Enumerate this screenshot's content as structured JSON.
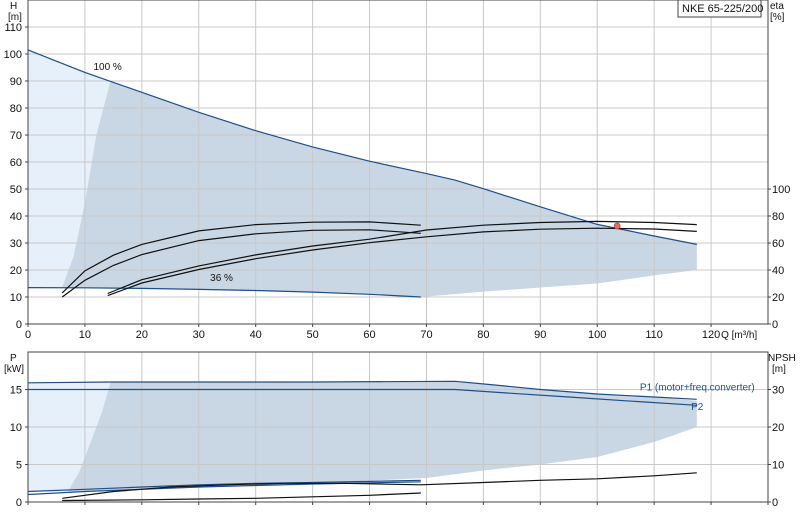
{
  "colors": {
    "grid": "#c8c8c8",
    "axis": "#444444",
    "envelope": "#c9d6e3",
    "lowflow": "#e6f0fb",
    "curve_blue": "#1e4f8a",
    "curve_black": "#111111",
    "duty_point": "#e07060"
  },
  "model_label": "NKE 65-225/200",
  "chart_data": [
    {
      "type": "line",
      "panel": "top",
      "title": "",
      "ylabel_left_name": "H",
      "ylabel_left_unit": "[m]",
      "ylabel_right_name": "eta",
      "ylabel_right_unit": "[%]",
      "xlabel": "Q [m³/h]",
      "xlim": [
        0,
        130
      ],
      "ylim_left": [
        0,
        120
      ],
      "ylim_right_scale": {
        "eta_0_at_H": 0,
        "eta_100_at_H": 50
      },
      "x_ticks": [
        0,
        10,
        20,
        30,
        40,
        50,
        60,
        70,
        80,
        90,
        100,
        110,
        120
      ],
      "y_ticks_left": [
        0,
        10,
        20,
        30,
        40,
        50,
        60,
        70,
        80,
        90,
        100,
        110
      ],
      "y_ticks_right": [
        0,
        20,
        40,
        60,
        80,
        100
      ],
      "grid": true,
      "envelope": {
        "upper": [
          [
            14.5,
            90
          ],
          [
            20,
            85.8
          ],
          [
            30,
            78.4
          ],
          [
            40,
            71.6
          ],
          [
            50,
            65.6
          ],
          [
            60,
            60.3
          ],
          [
            70,
            55.7
          ],
          [
            75,
            53.3
          ],
          [
            80,
            50.1
          ],
          [
            90,
            43.4
          ],
          [
            100,
            36.9
          ],
          [
            110,
            32.6
          ],
          [
            117.5,
            29.5
          ]
        ],
        "lower": [
          [
            117.5,
            20
          ],
          [
            110,
            18
          ],
          [
            100,
            15
          ],
          [
            90,
            13.5
          ],
          [
            80,
            12
          ],
          [
            69,
            10
          ],
          [
            50,
            11.8
          ],
          [
            30,
            12.8
          ],
          [
            6,
            13.5
          ]
        ],
        "left_edge": [
          [
            6,
            13.5
          ],
          [
            8,
            25
          ],
          [
            10,
            45
          ],
          [
            12,
            70
          ],
          [
            14.5,
            90
          ]
        ]
      },
      "lowflow_region": [
        [
          0,
          101.5
        ],
        [
          14.5,
          90
        ],
        [
          12,
          70
        ],
        [
          10,
          45
        ],
        [
          8,
          25
        ],
        [
          6,
          13.5
        ],
        [
          0,
          13.5
        ]
      ],
      "curves": [
        {
          "name": "100 %",
          "role": "head",
          "color_key": "curve_blue",
          "points": [
            [
              0,
              101.5
            ],
            [
              10,
              93.2
            ],
            [
              20,
              85.8
            ],
            [
              30,
              78.4
            ],
            [
              40,
              71.6
            ],
            [
              50,
              65.6
            ],
            [
              60,
              60.3
            ],
            [
              70,
              55.7
            ],
            [
              75,
              53.3
            ],
            [
              80,
              50.1
            ],
            [
              90,
              43.4
            ],
            [
              100,
              36.9
            ],
            [
              110,
              32.6
            ],
            [
              117.5,
              29.5
            ]
          ]
        },
        {
          "name": "36 %",
          "role": "head",
          "color_key": "curve_blue",
          "points": [
            [
              0,
              13.5
            ],
            [
              10,
              13.4
            ],
            [
              20,
              13.2
            ],
            [
              30,
              12.8
            ],
            [
              40,
              12.4
            ],
            [
              50,
              11.8
            ],
            [
              60,
              11.0
            ],
            [
              69,
              10.0
            ]
          ]
        },
        {
          "name": "",
          "role": "efficiency",
          "color_key": "curve_black",
          "points": [
            [
              6,
              11.5
            ],
            [
              10,
              19.7
            ],
            [
              15,
              25.5
            ],
            [
              20,
              29.5
            ],
            [
              30,
              34.5
            ],
            [
              40,
              36.8
            ],
            [
              50,
              37.7
            ],
            [
              60,
              37.8
            ],
            [
              69,
              36.6
            ]
          ]
        },
        {
          "name": "",
          "role": "efficiency",
          "color_key": "curve_black",
          "points": [
            [
              6,
              10
            ],
            [
              10,
              16.2
            ],
            [
              15,
              21.7
            ],
            [
              20,
              25.7
            ],
            [
              30,
              30.9
            ],
            [
              40,
              33.4
            ],
            [
              50,
              34.7
            ],
            [
              60,
              34.9
            ],
            [
              69,
              33.6
            ]
          ]
        },
        {
          "name": "",
          "role": "efficiency",
          "color_key": "curve_black",
          "points": [
            [
              14,
              11.3
            ],
            [
              20,
              16.4
            ],
            [
              30,
              21.5
            ],
            [
              40,
              25.6
            ],
            [
              50,
              28.9
            ],
            [
              60,
              31.4
            ],
            [
              70,
              34.8
            ],
            [
              80,
              36.6
            ],
            [
              90,
              37.6
            ],
            [
              100,
              38
            ],
            [
              110,
              37.6
            ],
            [
              117.5,
              36.8
            ]
          ]
        },
        {
          "name": "",
          "role": "efficiency",
          "color_key": "curve_black",
          "points": [
            [
              14,
              10.5
            ],
            [
              20,
              15.2
            ],
            [
              30,
              20.2
            ],
            [
              40,
              24.2
            ],
            [
              50,
              27.4
            ],
            [
              60,
              30.1
            ],
            [
              70,
              32.3
            ],
            [
              80,
              34.1
            ],
            [
              90,
              35.1
            ],
            [
              100,
              35.5
            ],
            [
              110,
              35.2
            ],
            [
              117.5,
              34.3
            ]
          ]
        }
      ],
      "duty_point": {
        "x": 103.5,
        "y": 36.3
      },
      "curve_labels": [
        {
          "text": "100 %",
          "x": 11.5,
          "y": 94
        },
        {
          "text": "36 %",
          "x": 32,
          "y": 16
        }
      ]
    },
    {
      "type": "line",
      "panel": "bottom",
      "title": "",
      "ylabel_left_name": "P",
      "ylabel_left_unit": "[kW]",
      "ylabel_right_name": "NPSH",
      "ylabel_right_unit": "[m]",
      "xlim": [
        0,
        130
      ],
      "ylim_left": [
        0,
        20
      ],
      "ylim_right_scale": {
        "npsh_0_at_P": 0,
        "npsh_10_at_P": 5
      },
      "y_ticks_left": [
        0,
        5,
        10,
        15
      ],
      "y_ticks_right": [
        0,
        10,
        20,
        30
      ],
      "grid": true,
      "envelope": {
        "upper": [
          [
            14.5,
            16
          ],
          [
            30,
            16
          ],
          [
            50,
            16
          ],
          [
            70,
            16
          ],
          [
            75,
            16.1
          ],
          [
            82,
            15.6
          ],
          [
            90,
            15
          ],
          [
            100,
            14.4
          ],
          [
            110,
            14
          ],
          [
            117.5,
            13.5
          ]
        ],
        "lower": [
          [
            117.5,
            10
          ],
          [
            110,
            8
          ],
          [
            100,
            6
          ],
          [
            90,
            5
          ],
          [
            80,
            4.2
          ],
          [
            70,
            3.2
          ],
          [
            50,
            2.5
          ],
          [
            30,
            1.9
          ],
          [
            15,
            1.5
          ],
          [
            7,
            1.4
          ]
        ],
        "left_edge": [
          [
            7,
            1.4
          ],
          [
            9,
            4
          ],
          [
            11,
            8
          ],
          [
            13,
            12
          ],
          [
            14.5,
            16
          ]
        ]
      },
      "lowflow_region": [
        [
          0,
          16
        ],
        [
          14.5,
          16
        ],
        [
          13,
          12
        ],
        [
          11,
          8
        ],
        [
          9,
          4
        ],
        [
          7,
          1.4
        ],
        [
          0,
          1.4
        ]
      ],
      "curves": [
        {
          "name": "P1 (motor+freq.converter)",
          "role": "power",
          "color_key": "curve_blue",
          "points": [
            [
              0,
              15.9
            ],
            [
              14.5,
              16
            ],
            [
              30,
              16
            ],
            [
              50,
              16
            ],
            [
              75,
              16.1
            ],
            [
              82,
              15.6
            ],
            [
              90,
              15
            ],
            [
              100,
              14.4
            ],
            [
              110,
              14
            ],
            [
              117.5,
              13.7
            ]
          ]
        },
        {
          "name": "P2",
          "role": "power",
          "color_key": "curve_blue",
          "points": [
            [
              0,
              15
            ],
            [
              20,
              15
            ],
            [
              40,
              15
            ],
            [
              60,
              15
            ],
            [
              75,
              15
            ],
            [
              85,
              14.5
            ],
            [
              95,
              14
            ],
            [
              105,
              13.5
            ],
            [
              117.5,
              12.9
            ]
          ]
        },
        {
          "name": "",
          "role": "power",
          "color_key": "curve_blue",
          "points": [
            [
              0,
              1.4
            ],
            [
              10,
              1.7
            ],
            [
              20,
              2.0
            ],
            [
              30,
              2.3
            ],
            [
              40,
              2.5
            ],
            [
              50,
              2.6
            ],
            [
              69,
              2.9
            ]
          ]
        },
        {
          "name": "",
          "role": "power",
          "color_key": "curve_blue",
          "points": [
            [
              0,
              1.0
            ],
            [
              10,
              1.4
            ],
            [
              20,
              1.7
            ],
            [
              30,
              2.0
            ],
            [
              40,
              2.2
            ],
            [
              50,
              2.4
            ],
            [
              69,
              2.7
            ]
          ]
        },
        {
          "name": "",
          "role": "npsh",
          "color_key": "curve_black",
          "points": [
            [
              6,
              0.5
            ],
            [
              15,
              1.4
            ],
            [
              25,
              2.0
            ],
            [
              35,
              2.3
            ],
            [
              45,
              2.5
            ],
            [
              55,
              2.5
            ],
            [
              69,
              2.3
            ],
            [
              80,
              2.6
            ],
            [
              90,
              2.9
            ],
            [
              100,
              3.1
            ],
            [
              110,
              3.5
            ],
            [
              117.5,
              3.9
            ]
          ]
        },
        {
          "name": "",
          "role": "npsh",
          "color_key": "curve_black",
          "points": [
            [
              6,
              0.2
            ],
            [
              20,
              0.3
            ],
            [
              30,
              0.4
            ],
            [
              40,
              0.5
            ],
            [
              50,
              0.7
            ],
            [
              60,
              0.9
            ],
            [
              69,
              1.2
            ]
          ]
        }
      ],
      "curve_labels": [
        {
          "text": "P1 (motor+freq.converter)",
          "x": 107.5,
          "y": 14.9
        },
        {
          "text": "P2",
          "x": 116.5,
          "y": 12.3
        }
      ]
    }
  ]
}
